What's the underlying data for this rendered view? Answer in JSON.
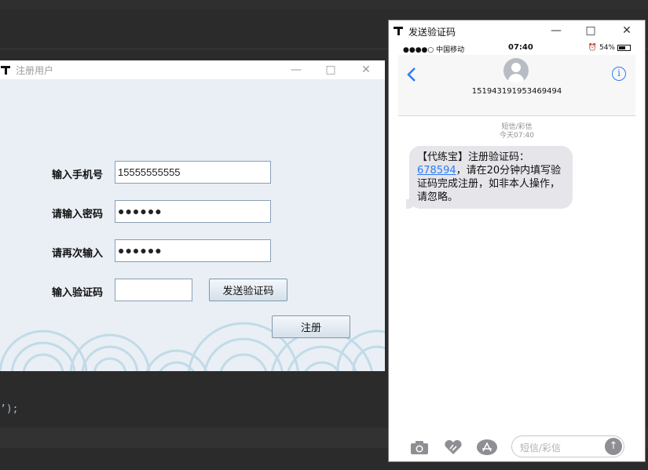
{
  "ide": {
    "code_fragment": "’);"
  },
  "register_window": {
    "title": "注册用户",
    "phone_label": "输入手机号",
    "phone_value": "15555555555",
    "password_label": "请输入密码",
    "password_value": "●●●●●●",
    "confirm_label": "请再次输入",
    "confirm_value": "●●●●●●",
    "code_label": "输入验证码",
    "code_value": "",
    "send_code_button": "发送验证码",
    "register_button": "注册"
  },
  "sms_window": {
    "title": "发送验证码",
    "status": {
      "carrier": "●●●●○ 中国移动",
      "time": "07:40",
      "battery": "54%"
    },
    "contact_number": "151943191953469494",
    "thread_label": "短信/彩信",
    "thread_time": "今天07:40",
    "message_prefix": "【代练宝】注册验证码：",
    "message_code": "678594",
    "message_suffix": "，请在20分钟内填写验证码完成注册，如非本人操作，请忽略。",
    "input_placeholder": "短信/彩信"
  },
  "colors": {
    "accent": "#2d7cf6",
    "ide_bg": "#2b2b2b",
    "form_bg": "#e9eff4",
    "bubble": "#e5e5ea"
  }
}
